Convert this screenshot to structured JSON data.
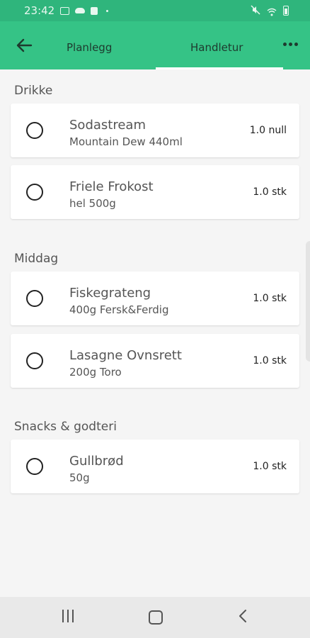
{
  "status_bar": {
    "time": "23:42",
    "icons": [
      "image-icon",
      "cloud-icon",
      "bag-icon",
      "dot-icon",
      "mute-icon",
      "wifi-icon",
      "battery-icon"
    ]
  },
  "app_bar": {
    "back_icon": "arrow-left-icon",
    "tabs": [
      {
        "label": "Planlegg",
        "selected": false
      },
      {
        "label": "Handletur",
        "selected": true
      }
    ],
    "more_icon": "more-horizontal-icon",
    "colors": {
      "primary": "#35c386",
      "status": "#2fb57c",
      "indicator": "#ffffff"
    }
  },
  "sections": [
    {
      "title": "Drikke",
      "items": [
        {
          "name": "Sodastream",
          "description": "Mountain Dew 440ml",
          "quantity": "1.0 null",
          "checked": false
        },
        {
          "name": "Friele Frokost",
          "description": "hel 500g",
          "quantity": "1.0 stk",
          "checked": false
        }
      ]
    },
    {
      "title": "Middag",
      "items": [
        {
          "name": "Fiskegrateng",
          "description": "400g Fersk&Ferdig",
          "quantity": "1.0 stk",
          "checked": false
        },
        {
          "name": "Lasagne Ovnsrett",
          "description": "200g Toro",
          "quantity": "1.0 stk",
          "checked": false
        }
      ]
    },
    {
      "title": "Snacks & godteri",
      "items": [
        {
          "name": "Gullbrød",
          "description": "50g",
          "quantity": "1.0 stk",
          "checked": false
        }
      ]
    }
  ],
  "nav_bar": {
    "icons": [
      "recent-apps-icon",
      "home-icon",
      "back-icon"
    ]
  }
}
